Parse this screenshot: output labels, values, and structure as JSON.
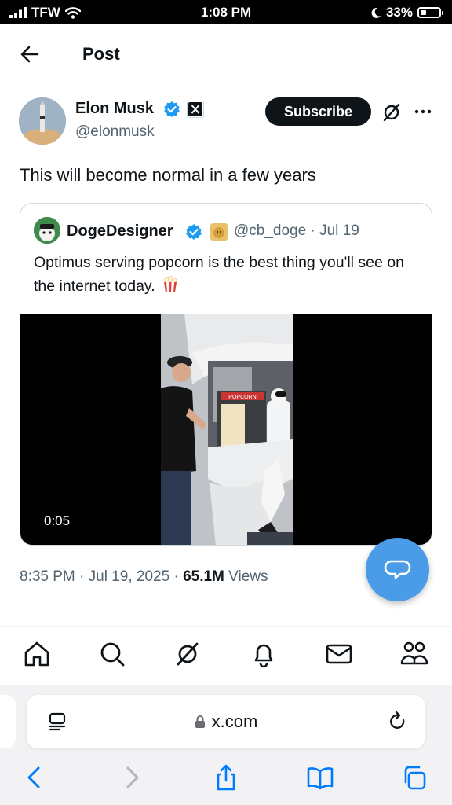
{
  "status_bar": {
    "carrier": "TFW",
    "time": "1:08 PM",
    "battery": "33%",
    "battery_level": 0.33
  },
  "header": {
    "title": "Post"
  },
  "post": {
    "author_name": "Elon Musk",
    "author_handle": "@elonmusk",
    "subscribe_label": "Subscribe",
    "text": "This will become normal in a few years",
    "timestamp": "8:35 PM · Jul 19, 2025 · ",
    "views_count": "65.1M",
    "views_label": " Views"
  },
  "quote": {
    "author_name": "DogeDesigner",
    "author_handle": "@cb_doge",
    "date": " · Jul 19",
    "text": "Optimus serving popcorn is the best thing you'll see on the internet today.",
    "video_time": "0:05",
    "video_sign": "POPCORN"
  },
  "tabs": [
    "home-icon",
    "search-icon",
    "grok-icon",
    "notifications-icon",
    "messages-icon",
    "communities-icon"
  ],
  "browser": {
    "url": "x.com",
    "icons": [
      "back-icon",
      "forward-icon",
      "share-icon",
      "bookmarks-icon",
      "tabs-icon"
    ]
  },
  "colors": {
    "accent": "#1d9bf0",
    "fab": "#4a9be8",
    "text": "#0f1419",
    "secondary": "#536471",
    "safari_blue": "#007aff"
  }
}
